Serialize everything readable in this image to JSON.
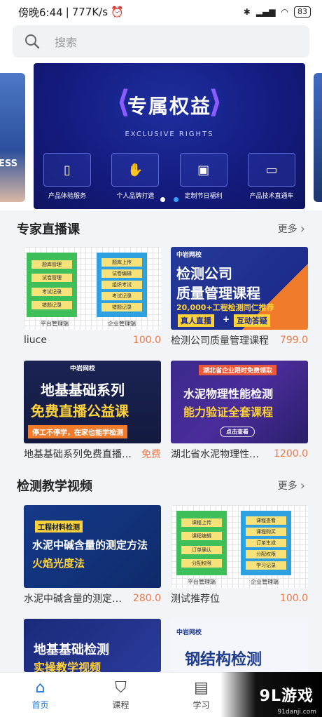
{
  "status_bar": {
    "time": "傍晚6:44",
    "speed": "777K/s",
    "battery": "83"
  },
  "search": {
    "placeholder": "搜索"
  },
  "banner": {
    "title": "专属权益",
    "subtitle": "EXCLUSIVE RIGHTS",
    "features": [
      {
        "label": "产品体验服务",
        "icon": "phone-icon"
      },
      {
        "label": "个人品牌打造",
        "icon": "hand-icon"
      },
      {
        "label": "定制节日福利",
        "icon": "gift-icon"
      },
      {
        "label": "产品技术直通车",
        "icon": "monitor-icon"
      }
    ],
    "side_left_text": "ESS"
  },
  "sections": {
    "live": {
      "title": "专家直播课",
      "more": "更多"
    },
    "video": {
      "title": "检测教学视频",
      "more": "更多"
    }
  },
  "live_courses": [
    {
      "name": "liuce",
      "price": "100.0"
    },
    {
      "name": "检测公司质量管理课程",
      "price": "799.0"
    },
    {
      "name": "地基基础系列免费直播…",
      "price": "免费"
    },
    {
      "name": "湖北省水泥物理性…",
      "price": "1200.0"
    }
  ],
  "video_courses": [
    {
      "name": "水泥中碱含量的测定方…",
      "price": "280.0"
    },
    {
      "name": "测试推荐位",
      "price": "100.0"
    }
  ],
  "thumbs": {
    "platform_panel": {
      "left_pills": [
        "题库管理",
        "试卷管理",
        "考试记录",
        "错题记录"
      ],
      "right_pills": [
        "题库上传",
        "试卷编辑",
        "组织考试",
        "考试记录",
        "错题记录"
      ],
      "left_caption": "平台管理端",
      "right_caption": "企业管理端"
    },
    "platform_panel_2": {
      "left_pills": [
        "课程上传",
        "课程编辑",
        "订单确认",
        "分配权限"
      ],
      "right_pills": [
        "课程查看",
        "课程购买",
        "订单生成",
        "分配权限",
        "学习记录"
      ],
      "left_caption": "平台管理端",
      "right_caption": "企业管理端"
    },
    "quality": {
      "logo": "中岩网校",
      "line1": "检测公司",
      "line2": "质量管理课程",
      "line3": "20,000+工程检测同仁推荐",
      "tag1": "真人直播",
      "plus": "+",
      "tag2": "互动答疑"
    },
    "foundation": {
      "logo": "中岩网校",
      "line1": "地基基础系列",
      "line2": "免费直播公益课",
      "line3": "停工不停学，在家也能学检测"
    },
    "cement": {
      "top": "湖北省企业限时免费领取",
      "line1": "水泥物理性能检测",
      "line2": "能力验证全套课程",
      "btn": "点击查看"
    },
    "alkali": {
      "tag": "工程材料检测",
      "line1": "水泥中碱含量的测定方法",
      "line2": "火焰光度法"
    },
    "foundation2": {
      "line1": "地基基础检测",
      "line2": "实操教学视频"
    },
    "steel": {
      "logo": "中岩网校",
      "line1": "钢结构检测"
    }
  },
  "tabs": [
    {
      "label": "首页",
      "icon": "home-icon"
    },
    {
      "label": "课程",
      "icon": "graduation-cap-icon"
    },
    {
      "label": "学习",
      "icon": "book-icon"
    }
  ],
  "watermark": {
    "text": "9L游戏",
    "site": "91danji.com"
  },
  "colors": {
    "accent": "#1e74d8",
    "price": "#e87a4a"
  }
}
